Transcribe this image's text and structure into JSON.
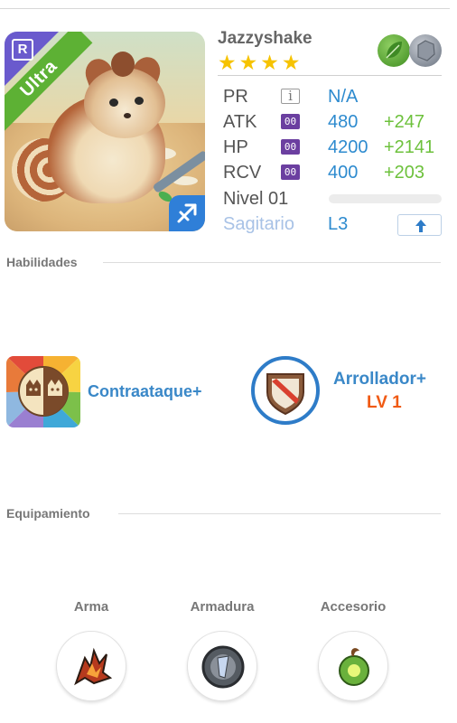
{
  "hero": {
    "name": "Jazzyshake",
    "rarity_label": "Ultra",
    "rarity_badge": "R",
    "stars": [
      "★",
      "★",
      "★",
      "★"
    ],
    "elements": [
      "leaf-icon",
      "rock-icon"
    ],
    "colors": {
      "ribbon": "#5db134",
      "value": "#2e8bcf",
      "bonus": "#6dc13c",
      "star": "#f6c300"
    }
  },
  "stats": {
    "pr": {
      "label": "PR",
      "value": "N/A"
    },
    "atk": {
      "label": "ATK",
      "badge": "00",
      "value": "480",
      "bonus": "+247"
    },
    "hp": {
      "label": "HP",
      "badge": "00",
      "value": "4200",
      "bonus": "+2141"
    },
    "rcv": {
      "label": "RCV",
      "badge": "00",
      "value": "400",
      "bonus": "+203"
    },
    "level": {
      "label": "Nivel 01",
      "progress": 0
    },
    "sign": {
      "label": "Sagitario",
      "value": "L3"
    }
  },
  "sections": {
    "skills": "Habilidades",
    "equipment": "Equipamiento"
  },
  "skills": {
    "skill": {
      "name": "Contraataque+"
    },
    "ability": {
      "name": "Arrollador+",
      "level": "LV 1"
    }
  },
  "equipment": {
    "slots": [
      {
        "label": "Arma"
      },
      {
        "label": "Armadura"
      },
      {
        "label": "Accesorio"
      }
    ]
  }
}
